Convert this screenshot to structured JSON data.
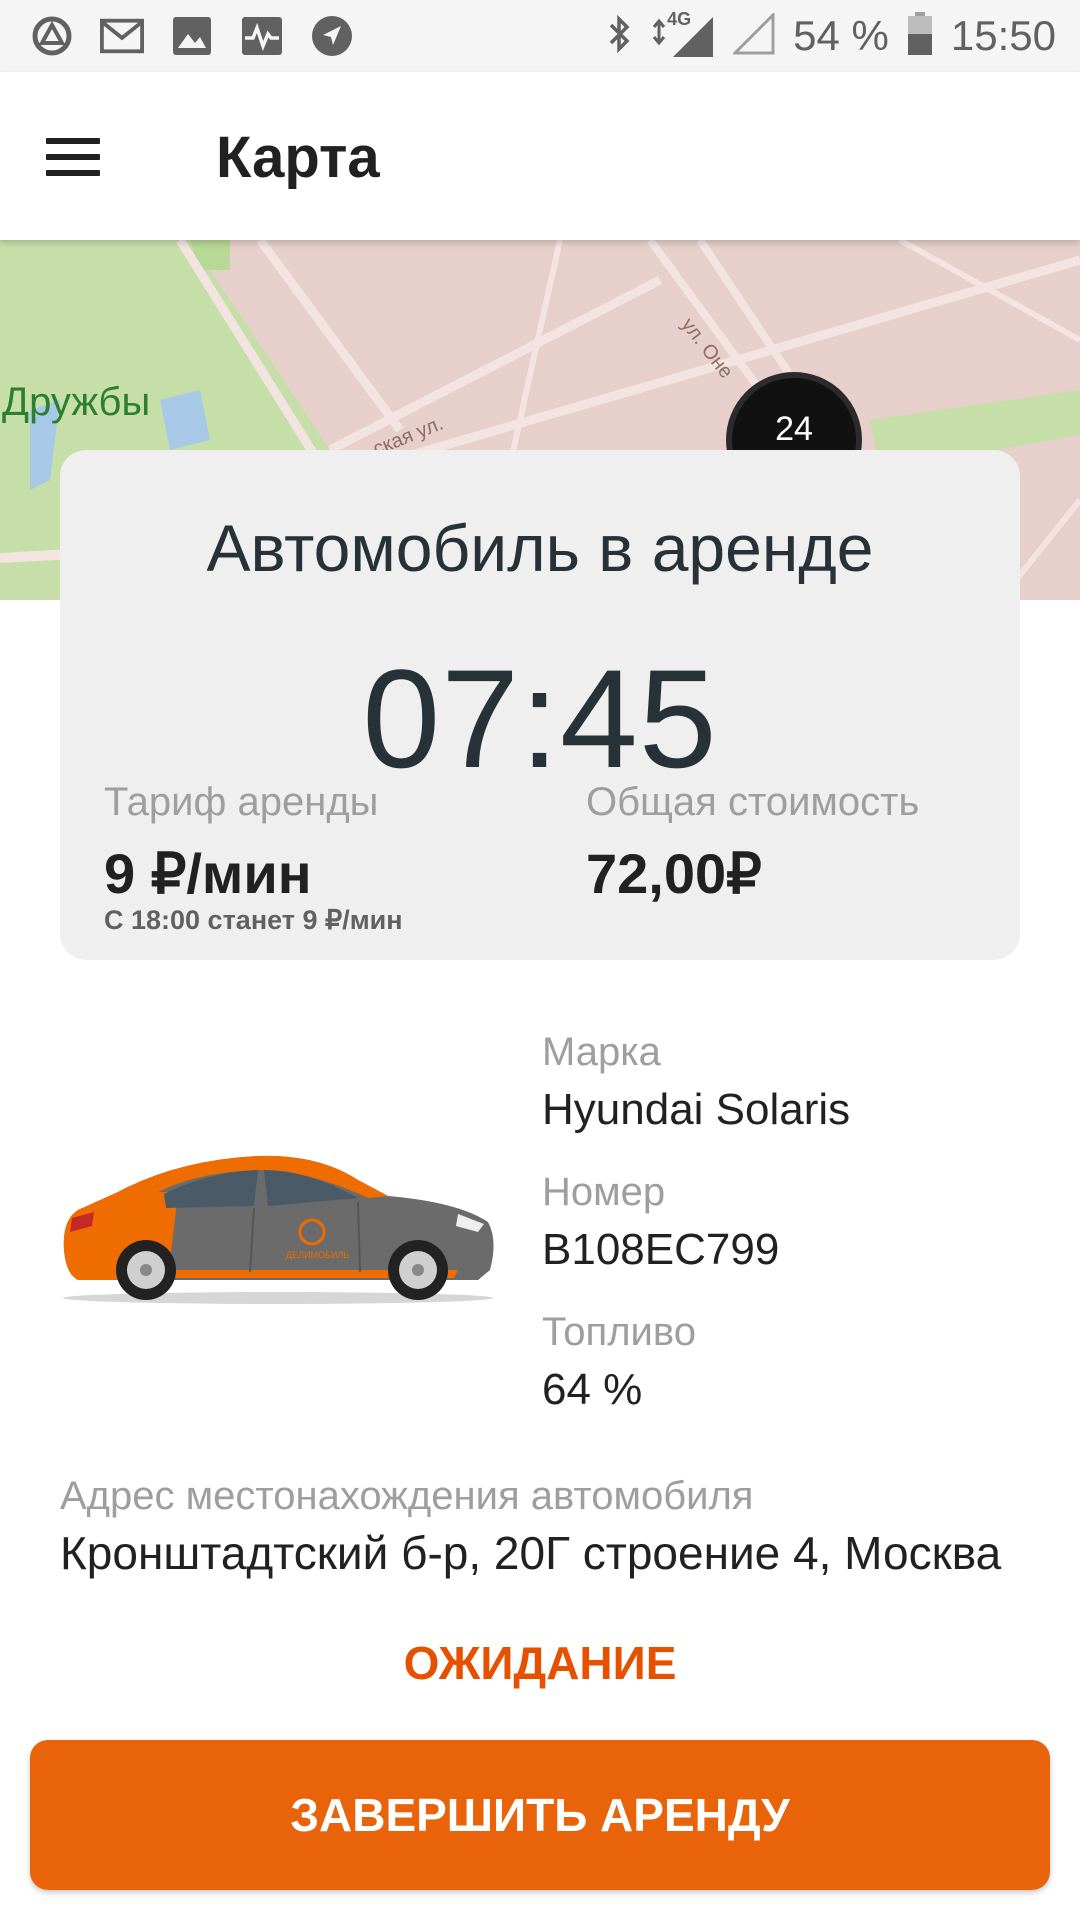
{
  "status_bar": {
    "left_icons": [
      "app-notification-icon",
      "mail-icon",
      "image-icon",
      "activity-icon",
      "navigation-icon"
    ],
    "right_icons": [
      "bluetooth-icon",
      "signal-4g-icon",
      "signal-empty-icon",
      "battery-icon"
    ],
    "network": "4G",
    "battery": "54 %",
    "time": "15:50"
  },
  "app_bar": {
    "title": "Карта",
    "menu_icon": "hamburger-menu-icon"
  },
  "map": {
    "park_label": "Дружбы",
    "street_1": "ул. Оне",
    "street_2": "ская ул.",
    "cluster_count": "24",
    "colors": {
      "land": "#e7cfcb",
      "park": "#c6dfa8",
      "water": "#a8c8e8"
    }
  },
  "rental_card": {
    "title": "Автомобиль в аренде",
    "timer": "07:45",
    "tariff_label": "Тариф аренды",
    "tariff_value": "9 ₽/мин",
    "tariff_note": "С 18:00 станет 9 ₽/мин",
    "total_label": "Общая стоимость",
    "total_value": "72,00₽"
  },
  "car": {
    "image_icon": "car-hyundai-solaris-icon",
    "brand_label": "Марка",
    "brand_value": "Hyundai Solaris",
    "plate_label": "Номер",
    "plate_value": "В108ЕС799",
    "fuel_label": "Топливо",
    "fuel_value": "64 %",
    "logo_text": "ДЕЛИМОБИЛЬ"
  },
  "address": {
    "label": "Адрес местонахождения автомобиля",
    "value": "Кронштадтский б-р, 20Г строение 4, Москва"
  },
  "status_label": "ОЖИДАНИЕ",
  "end_button": "ЗАВЕРШИТЬ АРЕНДУ",
  "accent_color": "#e8630a"
}
